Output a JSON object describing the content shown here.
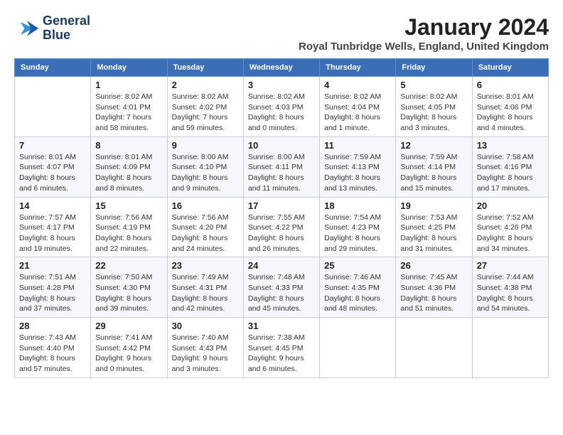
{
  "logo": {
    "line1": "General",
    "line2": "Blue"
  },
  "title": "January 2024",
  "location": "Royal Tunbridge Wells, England, United Kingdom",
  "days_of_week": [
    "Sunday",
    "Monday",
    "Tuesday",
    "Wednesday",
    "Thursday",
    "Friday",
    "Saturday"
  ],
  "weeks": [
    [
      {
        "day": "",
        "info": ""
      },
      {
        "day": "1",
        "info": "Sunrise: 8:02 AM\nSunset: 4:01 PM\nDaylight: 7 hours\nand 58 minutes."
      },
      {
        "day": "2",
        "info": "Sunrise: 8:02 AM\nSunset: 4:02 PM\nDaylight: 7 hours\nand 59 minutes."
      },
      {
        "day": "3",
        "info": "Sunrise: 8:02 AM\nSunset: 4:03 PM\nDaylight: 8 hours\nand 0 minutes."
      },
      {
        "day": "4",
        "info": "Sunrise: 8:02 AM\nSunset: 4:04 PM\nDaylight: 8 hours\nand 1 minute."
      },
      {
        "day": "5",
        "info": "Sunrise: 8:02 AM\nSunset: 4:05 PM\nDaylight: 8 hours\nand 3 minutes."
      },
      {
        "day": "6",
        "info": "Sunrise: 8:01 AM\nSunset: 4:06 PM\nDaylight: 8 hours\nand 4 minutes."
      }
    ],
    [
      {
        "day": "7",
        "info": "Sunrise: 8:01 AM\nSunset: 4:07 PM\nDaylight: 8 hours\nand 6 minutes."
      },
      {
        "day": "8",
        "info": "Sunrise: 8:01 AM\nSunset: 4:09 PM\nDaylight: 8 hours\nand 8 minutes."
      },
      {
        "day": "9",
        "info": "Sunrise: 8:00 AM\nSunset: 4:10 PM\nDaylight: 8 hours\nand 9 minutes."
      },
      {
        "day": "10",
        "info": "Sunrise: 8:00 AM\nSunset: 4:11 PM\nDaylight: 8 hours\nand 11 minutes."
      },
      {
        "day": "11",
        "info": "Sunrise: 7:59 AM\nSunset: 4:13 PM\nDaylight: 8 hours\nand 13 minutes."
      },
      {
        "day": "12",
        "info": "Sunrise: 7:59 AM\nSunset: 4:14 PM\nDaylight: 8 hours\nand 15 minutes."
      },
      {
        "day": "13",
        "info": "Sunrise: 7:58 AM\nSunset: 4:16 PM\nDaylight: 8 hours\nand 17 minutes."
      }
    ],
    [
      {
        "day": "14",
        "info": "Sunrise: 7:57 AM\nSunset: 4:17 PM\nDaylight: 8 hours\nand 19 minutes."
      },
      {
        "day": "15",
        "info": "Sunrise: 7:56 AM\nSunset: 4:19 PM\nDaylight: 8 hours\nand 22 minutes."
      },
      {
        "day": "16",
        "info": "Sunrise: 7:56 AM\nSunset: 4:20 PM\nDaylight: 8 hours\nand 24 minutes."
      },
      {
        "day": "17",
        "info": "Sunrise: 7:55 AM\nSunset: 4:22 PM\nDaylight: 8 hours\nand 26 minutes."
      },
      {
        "day": "18",
        "info": "Sunrise: 7:54 AM\nSunset: 4:23 PM\nDaylight: 8 hours\nand 29 minutes."
      },
      {
        "day": "19",
        "info": "Sunrise: 7:53 AM\nSunset: 4:25 PM\nDaylight: 8 hours\nand 31 minutes."
      },
      {
        "day": "20",
        "info": "Sunrise: 7:52 AM\nSunset: 4:26 PM\nDaylight: 8 hours\nand 34 minutes."
      }
    ],
    [
      {
        "day": "21",
        "info": "Sunrise: 7:51 AM\nSunset: 4:28 PM\nDaylight: 8 hours\nand 37 minutes."
      },
      {
        "day": "22",
        "info": "Sunrise: 7:50 AM\nSunset: 4:30 PM\nDaylight: 8 hours\nand 39 minutes."
      },
      {
        "day": "23",
        "info": "Sunrise: 7:49 AM\nSunset: 4:31 PM\nDaylight: 8 hours\nand 42 minutes."
      },
      {
        "day": "24",
        "info": "Sunrise: 7:48 AM\nSunset: 4:33 PM\nDaylight: 8 hours\nand 45 minutes."
      },
      {
        "day": "25",
        "info": "Sunrise: 7:46 AM\nSunset: 4:35 PM\nDaylight: 8 hours\nand 48 minutes."
      },
      {
        "day": "26",
        "info": "Sunrise: 7:45 AM\nSunset: 4:36 PM\nDaylight: 8 hours\nand 51 minutes."
      },
      {
        "day": "27",
        "info": "Sunrise: 7:44 AM\nSunset: 4:38 PM\nDaylight: 8 hours\nand 54 minutes."
      }
    ],
    [
      {
        "day": "28",
        "info": "Sunrise: 7:43 AM\nSunset: 4:40 PM\nDaylight: 8 hours\nand 57 minutes."
      },
      {
        "day": "29",
        "info": "Sunrise: 7:41 AM\nSunset: 4:42 PM\nDaylight: 9 hours\nand 0 minutes."
      },
      {
        "day": "30",
        "info": "Sunrise: 7:40 AM\nSunset: 4:43 PM\nDaylight: 9 hours\nand 3 minutes."
      },
      {
        "day": "31",
        "info": "Sunrise: 7:38 AM\nSunset: 4:45 PM\nDaylight: 9 hours\nand 6 minutes."
      },
      {
        "day": "",
        "info": ""
      },
      {
        "day": "",
        "info": ""
      },
      {
        "day": "",
        "info": ""
      }
    ]
  ]
}
